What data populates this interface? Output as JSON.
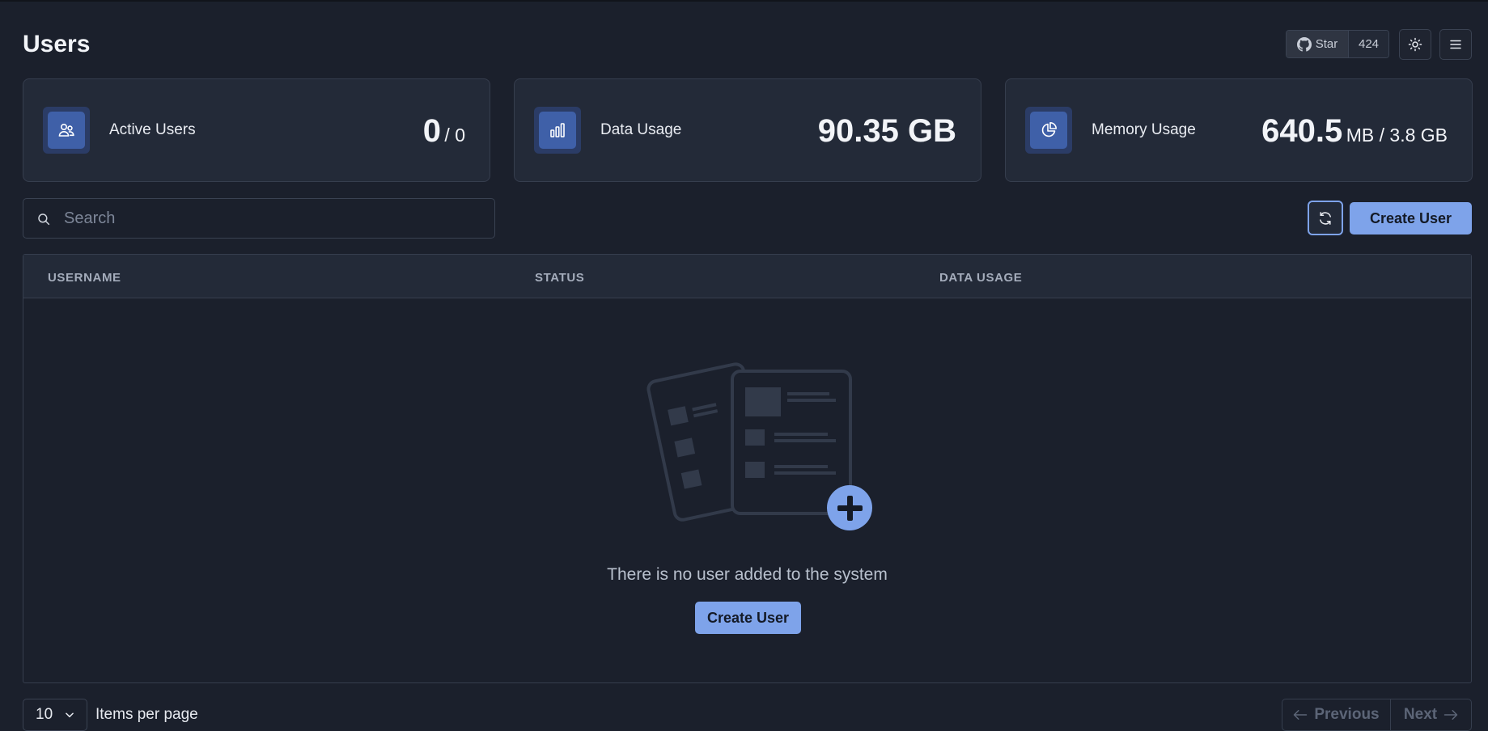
{
  "page": {
    "title": "Users"
  },
  "header": {
    "github": {
      "star_label": "Star",
      "star_count": "424"
    },
    "theme_icon": "sun-icon",
    "menu_icon": "hamburger-menu-icon"
  },
  "stats": [
    {
      "label": "Active Users",
      "value": "0",
      "suffix": "/ 0",
      "icon": "users-icon"
    },
    {
      "label": "Data Usage",
      "value": "90.35 GB",
      "suffix": "",
      "icon": "bar-chart-icon"
    },
    {
      "label": "Memory Usage",
      "value": "640.5",
      "suffix": "MB / 3.8 GB",
      "icon": "pie-chart-icon"
    }
  ],
  "toolbar": {
    "search_placeholder": "Search",
    "refresh_icon": "refresh-icon",
    "create_label": "Create User"
  },
  "table": {
    "columns": [
      "USERNAME",
      "STATUS",
      "DATA USAGE"
    ],
    "empty_message": "There is no user added to the system",
    "empty_create_label": "Create User"
  },
  "pagination": {
    "per_page_value": "10",
    "per_page_label": "Items per page",
    "prev_label": "Previous",
    "next_label": "Next"
  },
  "colors": {
    "background": "#1b202c",
    "card": "#232a38",
    "accent": "#7ea3ea",
    "icon_bg": "#3f60a8"
  }
}
